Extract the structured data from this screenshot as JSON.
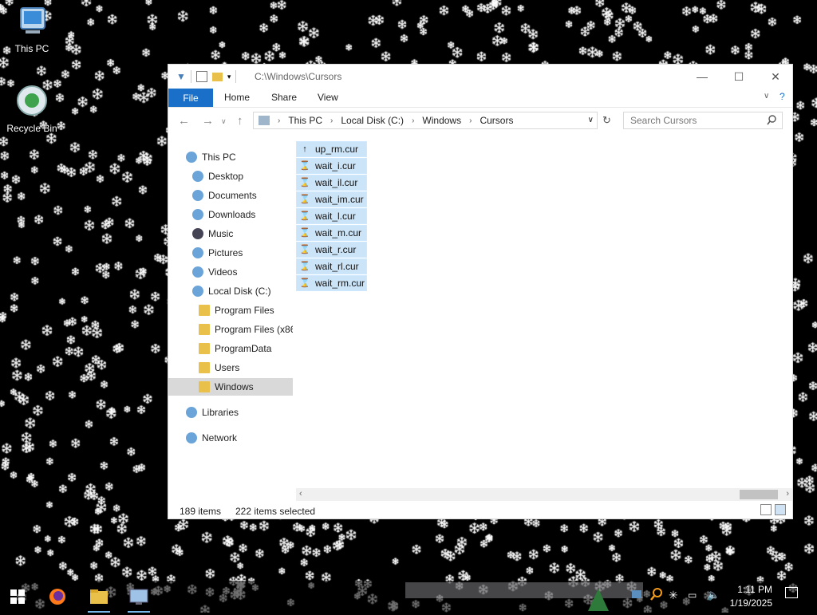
{
  "desktop": {
    "icons": [
      {
        "label": "This PC",
        "icon": "computer-icon"
      },
      {
        "label": "Recycle Bin",
        "icon": "recycle-bin-icon"
      }
    ]
  },
  "explorer": {
    "title_path": "C:\\Windows\\Cursors",
    "window_buttons": {
      "minimize": "—",
      "maximize": "☐",
      "close": "✕"
    },
    "ribbon": {
      "file": "File",
      "tabs": [
        "Home",
        "Share",
        "View"
      ]
    },
    "address": {
      "crumbs": [
        "This PC",
        "Local Disk (C:)",
        "Windows",
        "Cursors"
      ]
    },
    "search": {
      "placeholder": "Search Cursors"
    },
    "nav": [
      {
        "label": "This PC",
        "icon": "computer-icon",
        "level": 0
      },
      {
        "label": "Desktop",
        "icon": "desktop-icon",
        "level": 1
      },
      {
        "label": "Documents",
        "icon": "documents-icon",
        "level": 1
      },
      {
        "label": "Downloads",
        "icon": "downloads-icon",
        "level": 1
      },
      {
        "label": "Music",
        "icon": "music-icon",
        "level": 1
      },
      {
        "label": "Pictures",
        "icon": "pictures-icon",
        "level": 1
      },
      {
        "label": "Videos",
        "icon": "videos-icon",
        "level": 1
      },
      {
        "label": "Local Disk (C:)",
        "icon": "drive-icon",
        "level": 1
      },
      {
        "label": "Program Files",
        "icon": "folder-icon",
        "level": 2
      },
      {
        "label": "Program Files (x86",
        "icon": "folder-icon",
        "level": 2
      },
      {
        "label": "ProgramData",
        "icon": "folder-icon",
        "level": 2
      },
      {
        "label": "Users",
        "icon": "folder-icon",
        "level": 2
      },
      {
        "label": "Windows",
        "icon": "folder-icon",
        "level": 2,
        "selected": true
      },
      {
        "label": "Libraries",
        "icon": "libraries-icon",
        "level": 0
      },
      {
        "label": "Network",
        "icon": "network-icon",
        "level": 0
      }
    ],
    "files": [
      {
        "name": "up_rm.cur",
        "glyph": "↑"
      },
      {
        "name": "wait_i.cur",
        "glyph": "⌛"
      },
      {
        "name": "wait_il.cur",
        "glyph": "⌛"
      },
      {
        "name": "wait_im.cur",
        "glyph": "⌛"
      },
      {
        "name": "wait_l.cur",
        "glyph": "⌛"
      },
      {
        "name": "wait_m.cur",
        "glyph": "⌛"
      },
      {
        "name": "wait_r.cur",
        "glyph": "⌛"
      },
      {
        "name": "wait_rl.cur",
        "glyph": "⌛"
      },
      {
        "name": "wait_rm.cur",
        "glyph": "⌛"
      }
    ],
    "status": {
      "item_count": "189 items",
      "selected": "222 items selected"
    }
  },
  "taskbar": {
    "apps": [
      {
        "name": "start-button"
      },
      {
        "name": "firefox-icon"
      },
      {
        "name": "file-explorer-icon"
      },
      {
        "name": "control-panel-icon"
      }
    ],
    "clock": {
      "time": "1:11 PM",
      "date": "1/19/2025"
    },
    "colors": {
      "accent": "#1a70c8",
      "selection": "#cce4f7"
    }
  }
}
